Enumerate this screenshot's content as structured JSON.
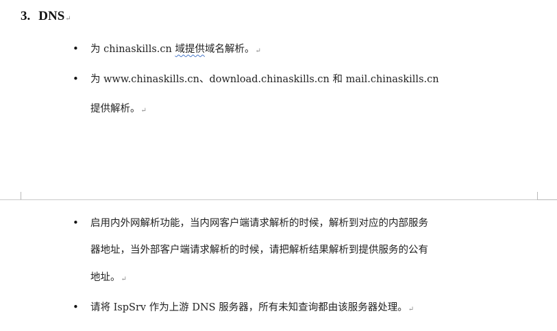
{
  "heading": {
    "number": "3.",
    "title": "DNS",
    "mark": "↵"
  },
  "bullets": [
    {
      "lines": [
        "为 chinaskills.cn ",
        "域提供",
        "域名解析。",
        "↵"
      ]
    },
    {
      "lines": [
        "为 www.chinaskills.cn、download.chinaskills.cn 和 mail.chinaskills.cn",
        "提供解析。",
        "↵"
      ]
    },
    {
      "lines": [
        "启用内外网解析功能，当内网客户端请求解析的时候，解析到对应的内部服务",
        "器地址，当外部客户端请求解析的时候，请把解析结果解析到提供服务的公有",
        "地址。",
        "↵"
      ]
    },
    {
      "lines": [
        "请将 IspSrv 作为上游 DNS 服务器，所有未知查询都由该服务器处理。",
        "↵"
      ]
    }
  ],
  "bullet_glyph": "•"
}
